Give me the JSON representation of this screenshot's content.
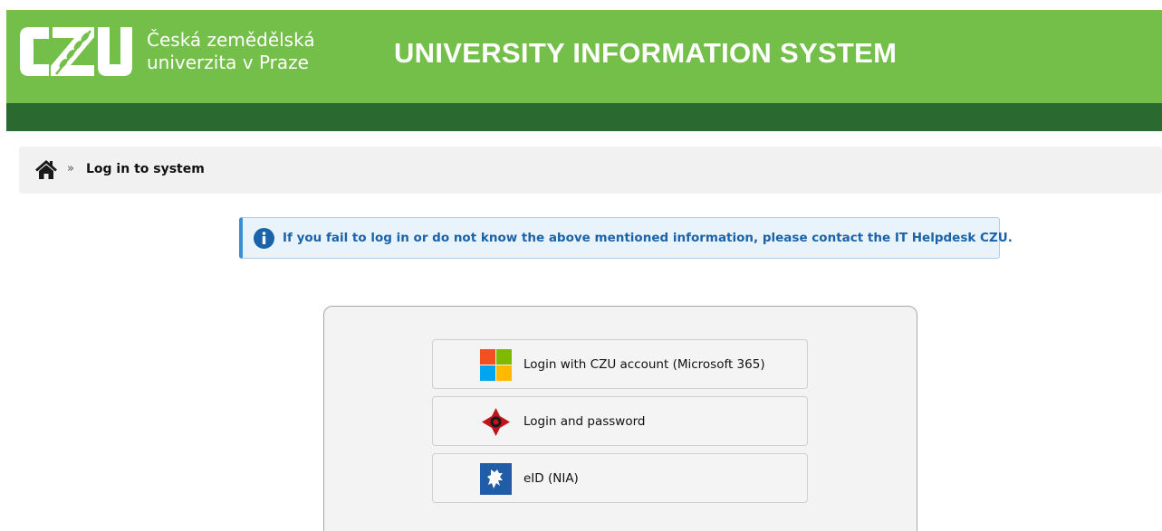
{
  "header": {
    "logo_text": "CZU",
    "university_name_line1": "Česká zemědělská",
    "university_name_line2": "univerzita v Praze",
    "system_title": "UNIVERSITY INFORMATION SYSTEM",
    "accent_color": "#74bf49",
    "subbar_color": "#2a6a30"
  },
  "breadcrumb": {
    "home_icon": "home-icon",
    "separator": "»",
    "current": "Log in to system"
  },
  "alert": {
    "icon": "info-icon",
    "text": "If you fail to log in or do not know the above mentioned information, please contact the IT Helpdesk CZU."
  },
  "login": {
    "options": [
      {
        "icon": "microsoft-icon",
        "label": "Login with CZU account (Microsoft 365)"
      },
      {
        "icon": "password-login-icon",
        "label": "Login and password"
      },
      {
        "icon": "eid-lion-icon",
        "label": "eID (NIA)"
      }
    ]
  }
}
